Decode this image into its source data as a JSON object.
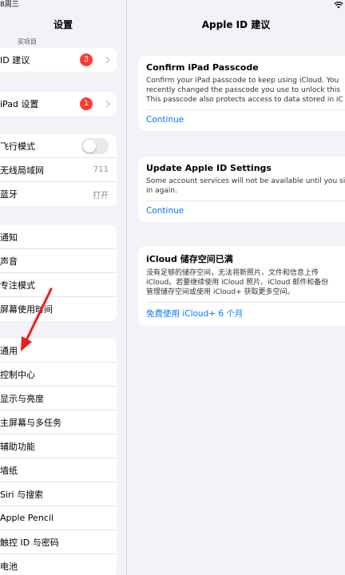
{
  "status": {
    "time": "8周三"
  },
  "left": {
    "title": "设置",
    "top_sub": "买项目",
    "group_top": [
      {
        "label": "ID 建议",
        "badge": "3"
      }
    ],
    "group_update": [
      {
        "label": "iPad 设置",
        "badge": "1"
      }
    ],
    "group_net": [
      {
        "label": "飞行模式"
      },
      {
        "label": "无线局域网",
        "value": "711"
      },
      {
        "label": "蓝牙",
        "value": "打开"
      }
    ],
    "group_notify": [
      {
        "label": "通知"
      },
      {
        "label": "声音"
      },
      {
        "label": "专注模式"
      },
      {
        "label": "屏幕使用时间"
      }
    ],
    "group_general": [
      {
        "label": "通用"
      },
      {
        "label": "控制中心"
      },
      {
        "label": "显示与亮度"
      },
      {
        "label": "主屏幕与多任务"
      },
      {
        "label": "辅助功能"
      },
      {
        "label": "墙纸"
      },
      {
        "label": "Siri 与搜索"
      },
      {
        "label": "Apple Pencil"
      },
      {
        "label": "触控 ID 与密码"
      },
      {
        "label": "电池"
      }
    ]
  },
  "right": {
    "title": "Apple ID 建议",
    "cards": [
      {
        "title": "Confirm iPad Passcode",
        "lines": [
          "Confirm your iPad passcode to keep using iCloud. You",
          "recently changed the passcode you use to unlock this",
          "This passcode also protects access to data stored in iC"
        ],
        "link": "Continue"
      },
      {
        "title": "Update Apple ID Settings",
        "lines": [
          "Some account services will not be available until you si",
          "in again."
        ],
        "link": "Continue"
      },
      {
        "title": "iCloud 储存空间已满",
        "lines": [
          "没有足够的储存空间，无法将新照片、文件和信息上传",
          "iCloud。若要继续使用 iCloud 照片、iCloud 邮件和备份",
          "管理储存空间或使用 iCloud+ 获取更多空间。"
        ],
        "link": "免费使用 iCloud+ 6 个月"
      }
    ]
  },
  "colors": {
    "accent": "#007aff",
    "badge": "#ff3b30",
    "arrow": "#e8201c"
  },
  "icons": [
    "wifi-icon",
    "chevron-right-icon",
    "arrow-annotation"
  ]
}
